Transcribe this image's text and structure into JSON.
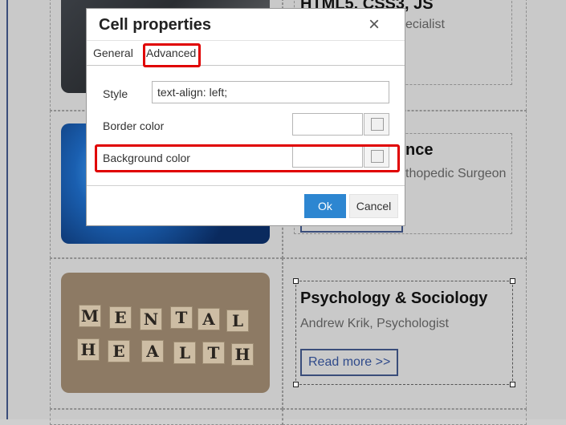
{
  "background": {
    "top_card_title_partial": "HTML5, CSS3, JS",
    "top_card_sub_partial": "ecialist",
    "mid_card_title_partial": "nce",
    "mid_card_sub_partial": "thopedic Surgeon",
    "bottom_card": {
      "title": "Psychology & Sociology",
      "subtitle": "Andrew Krik, Psychologist",
      "read_more": "Read more >>"
    },
    "tiles_row1": [
      "M",
      "E",
      "N",
      "T",
      "A",
      "L"
    ],
    "tiles_row2": [
      "H",
      "E",
      "A",
      "L",
      "T",
      "H"
    ]
  },
  "dialog": {
    "title": "Cell properties",
    "close_icon": "×",
    "tabs": [
      {
        "label": "General",
        "active": false
      },
      {
        "label": "Advanced",
        "active": true
      }
    ],
    "fields": {
      "style_label": "Style",
      "style_value": "text-align: left;",
      "border_color_label": "Border color",
      "border_color_value": "",
      "background_color_label": "Background color",
      "background_color_value": ""
    },
    "buttons": {
      "ok": "Ok",
      "cancel": "Cancel"
    }
  },
  "colors": {
    "highlight": "#e00000",
    "ok_button": "#2d86d1",
    "link_border": "#3a4d7a"
  }
}
